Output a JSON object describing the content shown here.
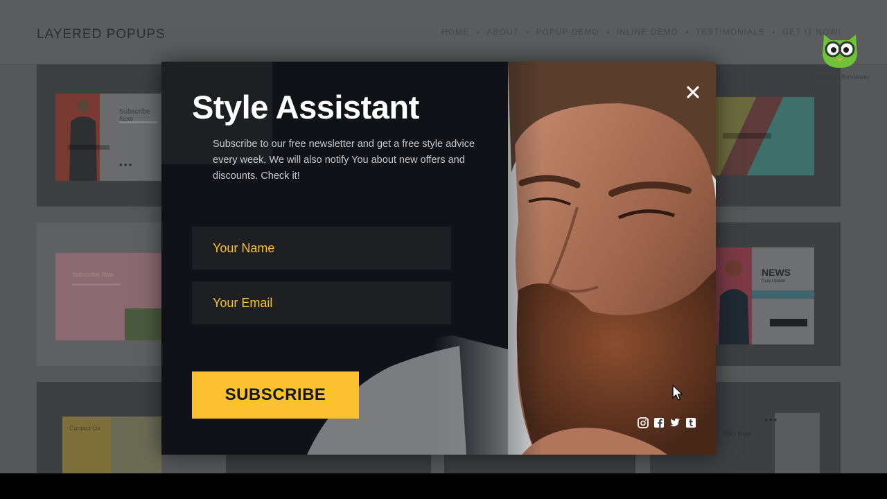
{
  "site": {
    "logo": "LAYERED POPUPS",
    "nav": [
      "HOME",
      "ABOUT",
      "POPUP DEMO",
      "INLINE DEMO",
      "TESTIMONIALS",
      "GET IT NOW!"
    ],
    "badge": "Template Reviewer",
    "thumb_texts": {
      "subscribe_now": "Subscribe Now",
      "subscribe_now_pink": "Subscribe Now",
      "news": "NEWS",
      "daily_update": "Daily Update",
      "contact_us": "Contact Us",
      "join_now": "Join Now"
    }
  },
  "popup": {
    "title": "Style Assistant",
    "description": "Subscribe to our free newsletter and get a free style advice every week. We will also notify You about new offers and discounts. Check it!",
    "name_placeholder": "Your Name",
    "email_placeholder": "Your Email",
    "subscribe_label": "SUBSCRIBE",
    "close_glyph": "×",
    "social_icons": [
      "instagram-icon",
      "facebook-icon",
      "twitter-icon",
      "tumblr-icon"
    ]
  },
  "colors": {
    "accent_yellow": "#fcc130",
    "placeholder_yellow": "#f7c133",
    "popup_bg": "#101217",
    "field_bg": "#1d1f23"
  }
}
